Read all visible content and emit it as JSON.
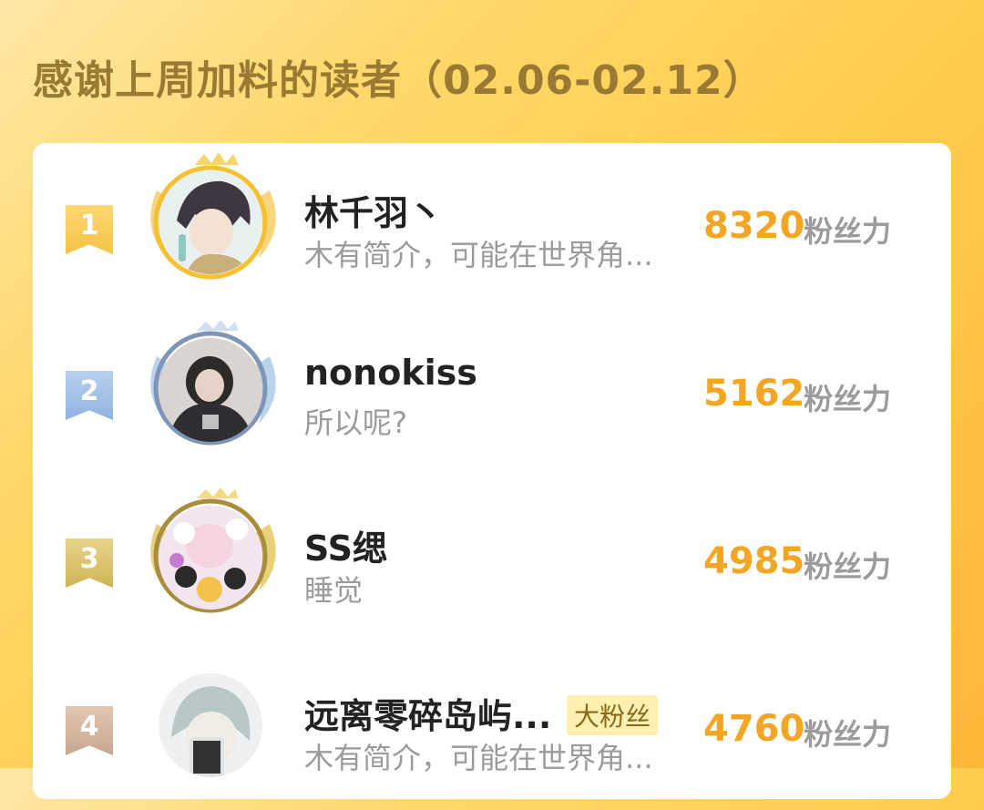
{
  "header": {
    "title": "感谢上周加料的读者（02.06-02.12）"
  },
  "colors": {
    "accent": "#f2a623",
    "gold": "#f5c246",
    "silver": "#8fb3e0",
    "bronze": "#cfb355"
  },
  "readers": [
    {
      "rank": "1",
      "name": "林千羽丶",
      "bio": "木有简介，可能在世界角...",
      "score": "8320",
      "unit": "粉丝力",
      "tag": ""
    },
    {
      "rank": "2",
      "name": "nonokiss",
      "bio": "所以呢?",
      "score": "5162",
      "unit": "粉丝力",
      "tag": ""
    },
    {
      "rank": "3",
      "name": "SS缌",
      "bio": "睡觉",
      "score": "4985",
      "unit": "粉丝力",
      "tag": ""
    },
    {
      "rank": "4",
      "name": "远离零碎岛屿...",
      "bio": "木有简介，可能在世界角...",
      "score": "4760",
      "unit": "粉丝力",
      "tag": "大粉丝"
    }
  ]
}
